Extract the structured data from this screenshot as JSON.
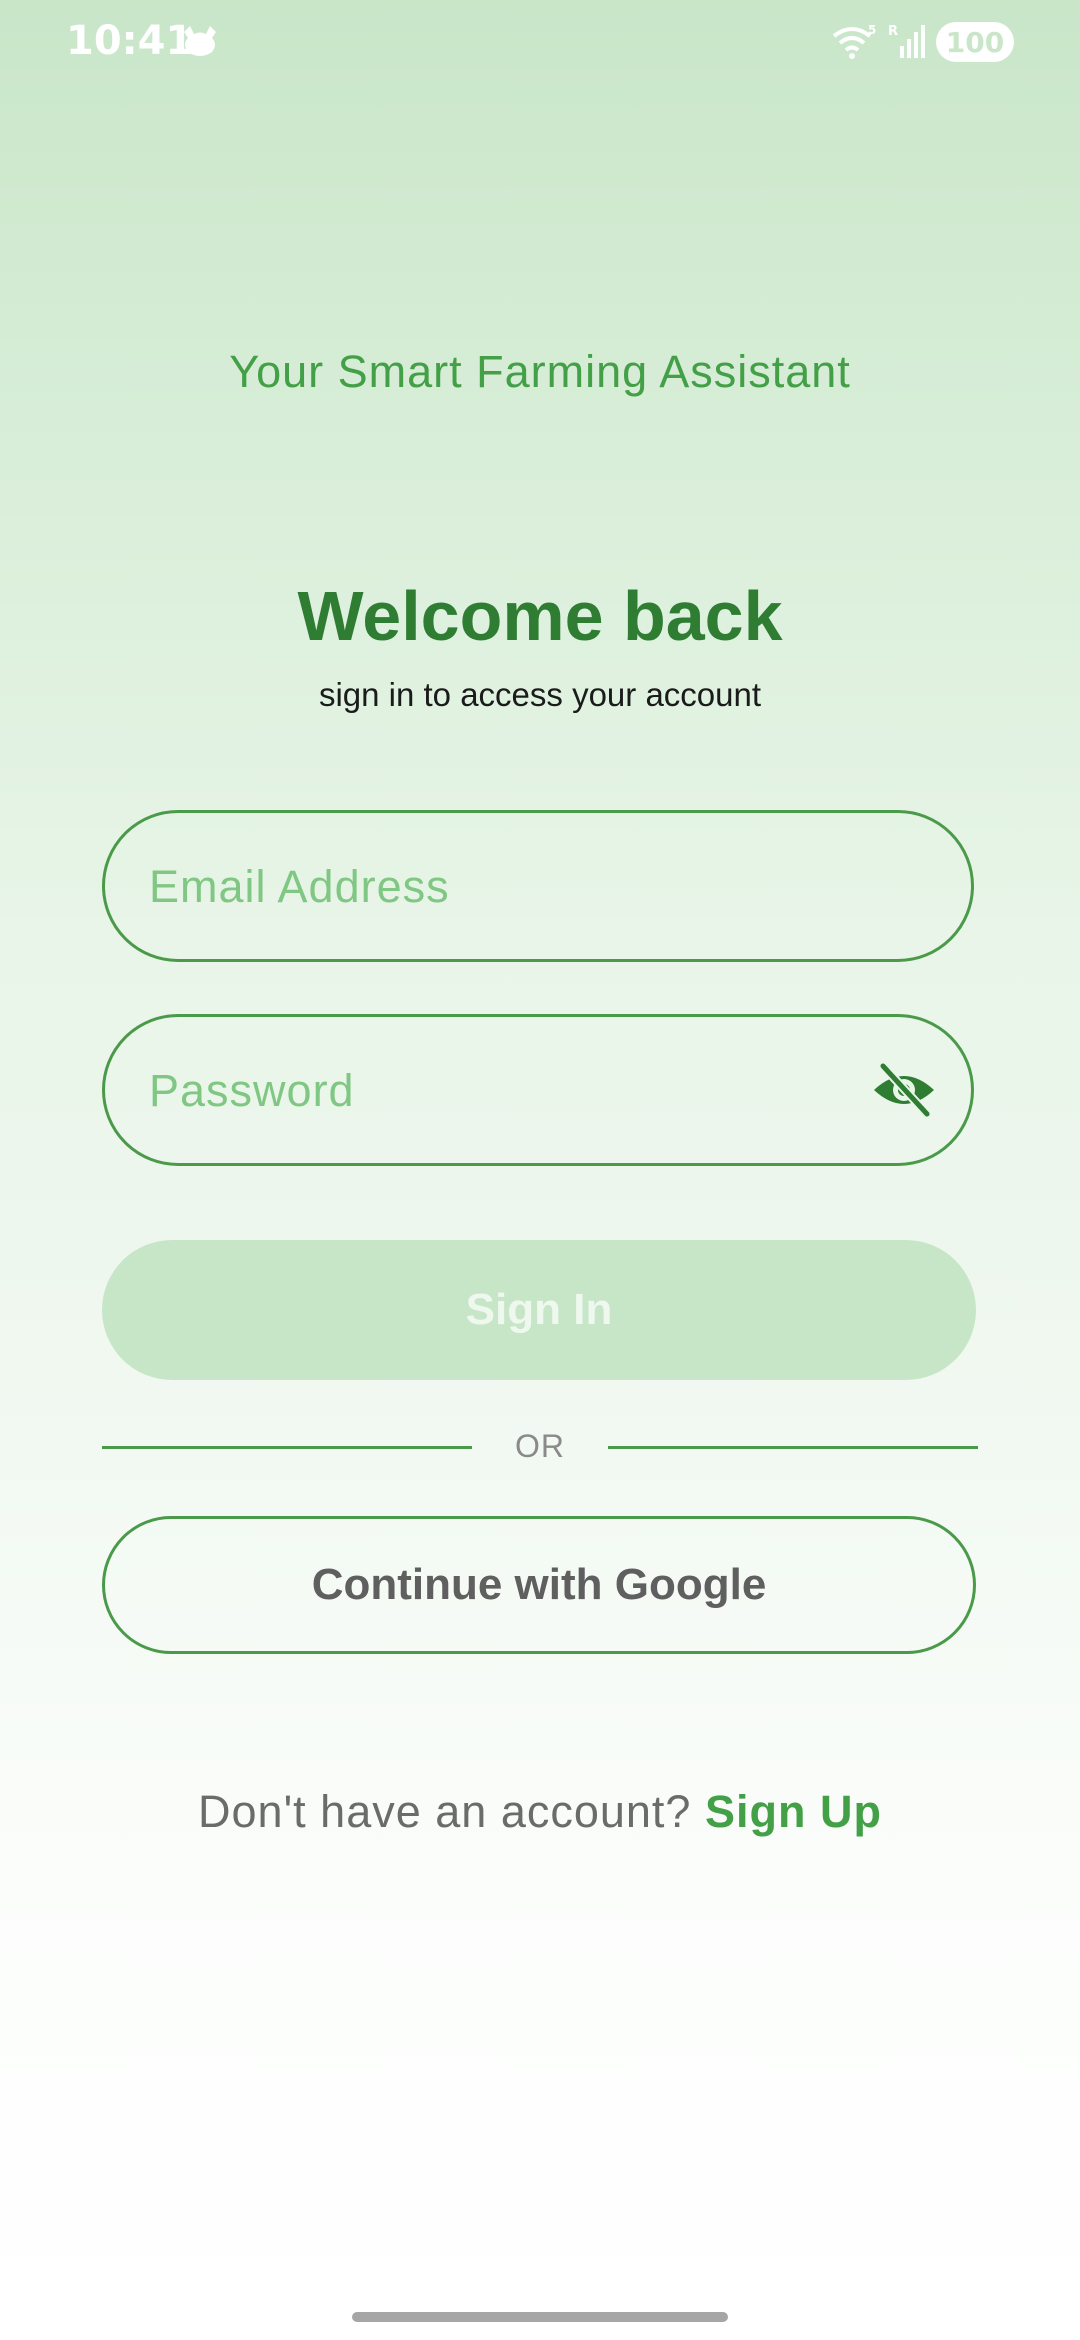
{
  "status_bar": {
    "time": "10:41",
    "battery": "100",
    "network_label": "5",
    "roaming_label": "R"
  },
  "app": {
    "tagline": "Your Smart Farming Assistant",
    "title": "Welcome back",
    "subtitle": "sign in to access your account"
  },
  "form": {
    "email_placeholder": "Email Address",
    "email_value": "",
    "password_placeholder": "Password",
    "password_value": "",
    "password_toggle_icon": "eye-off-icon",
    "signin_label": "Sign In",
    "signin_enabled": false,
    "divider_label": "OR",
    "google_label": "Continue with Google"
  },
  "footer": {
    "prompt": "Don't have an account?",
    "signup_label": "Sign Up"
  },
  "colors": {
    "primary": "#2e7d32",
    "accent": "#43a047",
    "placeholder": "#81c784",
    "border": "#4a9a4a",
    "disabled_button": "#c7e6c8"
  }
}
